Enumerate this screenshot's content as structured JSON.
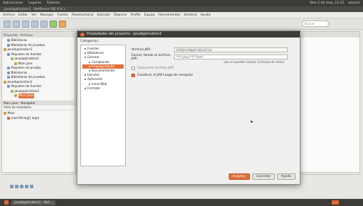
{
  "os_panel": {
    "left_items": [
      "Aplicaciones",
      "Lugares",
      "Sistema"
    ],
    "right_clock": "dom 1 de may, 12:15",
    "user": "usuario"
  },
  "ide_title": "JavaApplication1 - NetBeans IDE 6.9.1",
  "menubar": [
    "Archivo",
    "Editar",
    "Ver",
    "Navegar",
    "Fuente",
    "Reestructurar",
    "Ejecutar",
    "Depurar",
    "Profile",
    "Equipo",
    "Herramientas",
    "Ventana",
    "Ayuda"
  ],
  "toolbar": {
    "search_placeholder": "Buscar"
  },
  "left_panel": {
    "tabs": [
      "Proyectos",
      "Archivos"
    ],
    "tree": [
      {
        "label": "Bibliotecas",
        "depth": 1
      },
      {
        "label": "Bibliotecas de pruebas",
        "depth": 1
      },
      {
        "label": "JavaApplication1",
        "depth": 0
      },
      {
        "label": "Paquetes de fuentes",
        "depth": 1
      },
      {
        "label": "javaapplication1",
        "depth": 2
      },
      {
        "label": "Main.java",
        "depth": 3
      },
      {
        "label": "Paquetes de prueba",
        "depth": 1
      },
      {
        "label": "Bibliotecas",
        "depth": 1
      },
      {
        "label": "Bibliotecas de pruebas",
        "depth": 1
      },
      {
        "label": "JavaApplication2",
        "depth": 0
      },
      {
        "label": "Paquetes de fuentes",
        "depth": 1
      },
      {
        "label": "javaapplication2",
        "depth": 2
      },
      {
        "label": "Main.java",
        "depth": 3,
        "selected": true
      }
    ],
    "navigator_title": "Main.java - Navigator",
    "navigator_sub": "Vista de miembros",
    "navigator_items": [
      "Main",
      "main(String[] args)"
    ]
  },
  "dialog": {
    "title": "Propiedades del proyecto - JavaApplication2",
    "categories_label": "Categorías:",
    "categories": [
      {
        "label": "Fuentes",
        "depth": 0
      },
      {
        "label": "Bibliotecas",
        "depth": 0
      },
      {
        "label": "Generar",
        "depth": 0
      },
      {
        "label": "Compilando",
        "depth": 1
      },
      {
        "label": "Empaquetando",
        "depth": 1,
        "selected": true
      },
      {
        "label": "Documentando",
        "depth": 1
      },
      {
        "label": "Ejecutar",
        "depth": 0
      },
      {
        "label": "Aplicación",
        "depth": 0
      },
      {
        "label": "Inicio Web",
        "depth": 1
      },
      {
        "label": "Formato",
        "depth": 0
      }
    ],
    "jar_label": "Archivo JAR:",
    "jar_value": "dist/JavaApplication2.jar",
    "exclude_label": "Excluir desde el archivo JAR:",
    "exclude_value": "**/*.java,**/*.form",
    "exclude_hint": "(los se pueden excluir archivos de clase)",
    "compress_label": "Comprimir archivo JAR",
    "compress_checked": false,
    "build_jar_label": "Construir el JAR luego de compilar",
    "build_jar_checked": true,
    "buttons": {
      "ok": "Aceptar",
      "cancel": "Cancelar",
      "help": "Ayuda"
    }
  },
  "taskbar": {
    "task": "JavaApplication1 - Net..."
  }
}
